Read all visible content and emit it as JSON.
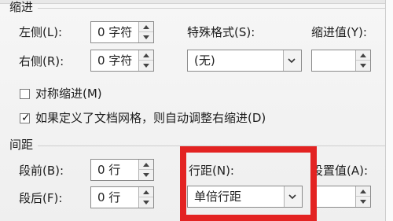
{
  "indentation": {
    "title": "缩进",
    "left_label": "左侧(L):",
    "left_value": "0 字符",
    "right_label": "右侧(R):",
    "right_value": "0 字符",
    "special_label": "特殊格式(S):",
    "special_value": "(无)",
    "indent_value_label": "缩进值(Y):",
    "indent_value": "",
    "symmetric_label": "对称缩进(M)",
    "auto_adjust_label": "如果定义了文档网格，则自动调整右缩进(D)",
    "symmetric_checked": false,
    "auto_adjust_checked": true
  },
  "spacing": {
    "title": "间距",
    "before_label": "段前(B):",
    "before_value": "0 行",
    "after_label": "段后(F):",
    "after_value": "0 行",
    "line_spacing_label": "行距(N):",
    "line_spacing_value": "单倍行距",
    "setting_label": "设置值(A):",
    "setting_value": ""
  },
  "colors": {
    "highlight": "#e32322"
  },
  "icons": {
    "spin_up": "spin-up-icon",
    "spin_down": "spin-down-icon",
    "dropdown": "chevron-down-icon",
    "check": "checkmark-icon"
  }
}
